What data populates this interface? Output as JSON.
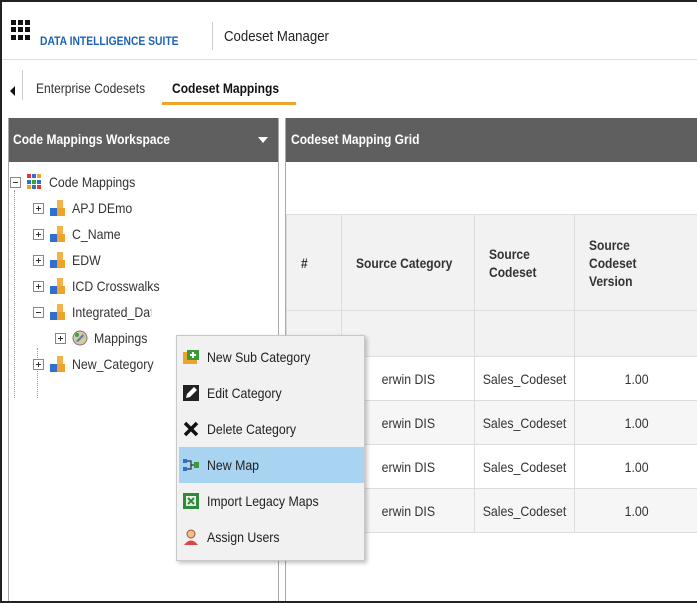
{
  "header": {
    "suite_name": "DATA INTELLIGENCE SUITE",
    "app_title": "Codeset Manager"
  },
  "tabs": [
    {
      "label": "Enterprise Codesets",
      "active": false
    },
    {
      "label": "Codeset Mappings",
      "active": true
    }
  ],
  "workspace": {
    "title": "Code Mappings Workspace",
    "root": "Code Mappings",
    "items": [
      {
        "label": "APJ DEmo"
      },
      {
        "label": "C_Name"
      },
      {
        "label": "EDW"
      },
      {
        "label": "ICD Crosswalks"
      },
      {
        "label": "Integrated_Data"
      },
      {
        "label": "Mappings"
      },
      {
        "label": "New_Category"
      }
    ]
  },
  "grid": {
    "title": "Codeset Mapping Grid",
    "columns": [
      "#",
      "Source Category",
      "Source Codeset",
      "Source Codeset Version"
    ],
    "rows": [
      {
        "category": "erwin DIS",
        "codeset": "Sales_Codeset",
        "version": "1.00"
      },
      {
        "category": "erwin DIS",
        "codeset": "Sales_Codeset",
        "version": "1.00"
      },
      {
        "category": "erwin DIS",
        "codeset": "Sales_Codeset",
        "version": "1.00"
      },
      {
        "category": "erwin DIS",
        "codeset": "Sales_Codeset",
        "version": "1.00"
      }
    ]
  },
  "context_menu": {
    "items": [
      {
        "label": "New Sub Category",
        "icon": "new-sub-category-icon"
      },
      {
        "label": "Edit Category",
        "icon": "pencil-icon"
      },
      {
        "label": "Delete Category",
        "icon": "delete-x-icon"
      },
      {
        "label": "New Map",
        "icon": "new-map-icon",
        "highlighted": true
      },
      {
        "label": "Import Legacy Maps",
        "icon": "excel-import-icon"
      },
      {
        "label": "Assign Users",
        "icon": "user-icon"
      }
    ]
  },
  "colors": {
    "accent": "#f0a32a",
    "brand_blue": "#1c63b6",
    "panel_header": "#5f5f5f",
    "menu_highlight": "#a8d3f1"
  }
}
